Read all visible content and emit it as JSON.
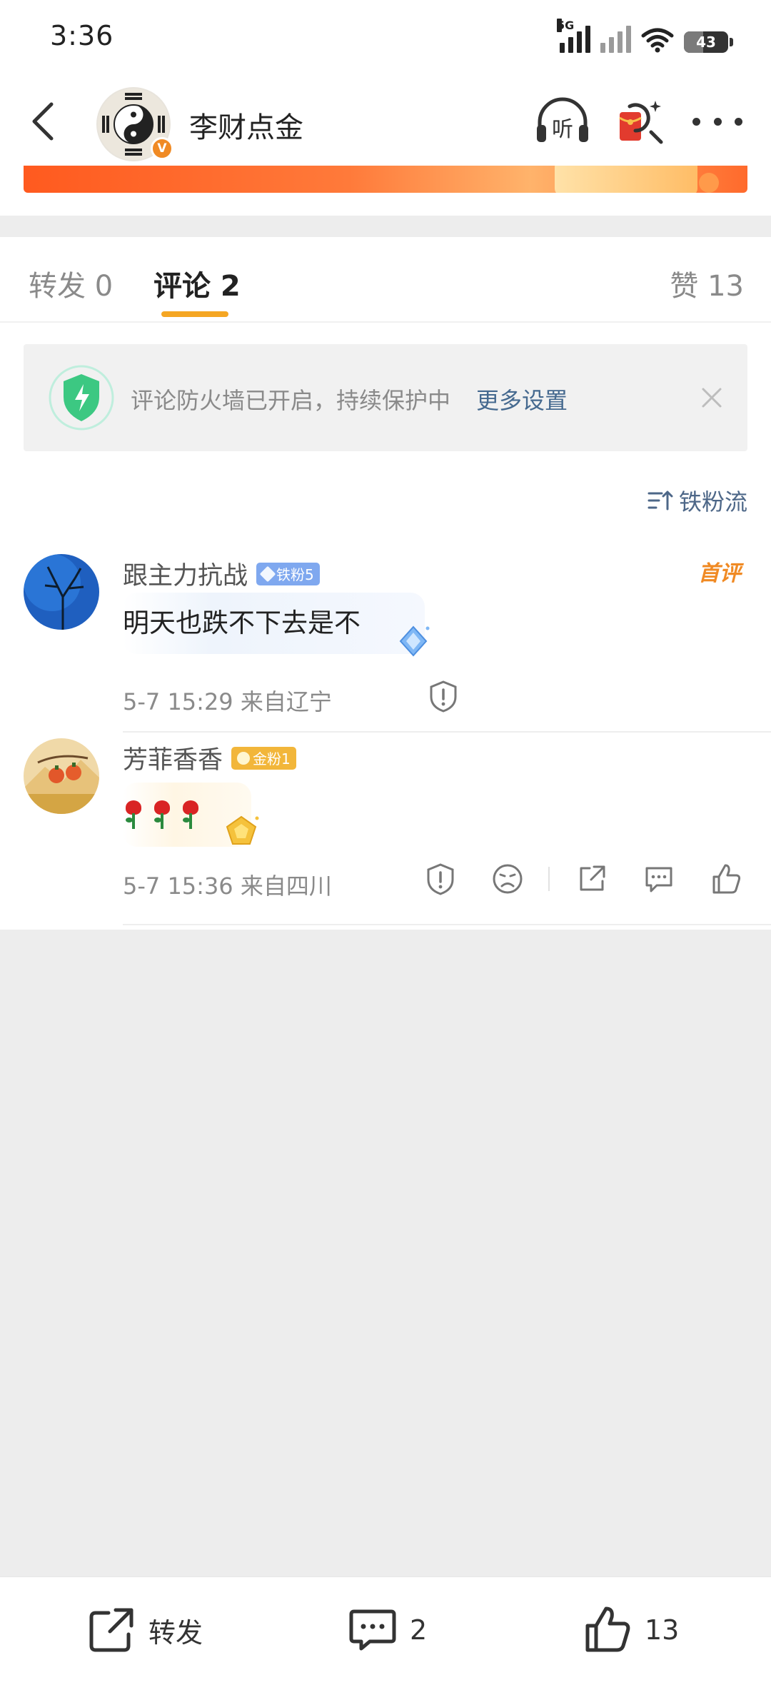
{
  "status_bar": {
    "time": "3:36",
    "network_label": "5G",
    "battery_level": "43",
    "battery_fraction": 0.43
  },
  "header": {
    "account_name": "李财点金",
    "verified_badge": "V",
    "icons": [
      "back-icon",
      "headphones-listen-icon",
      "red-envelope-search-icon",
      "more-icon"
    ],
    "listen_label": "听"
  },
  "tabs": {
    "repost": "转发 0",
    "comment": "评论 2",
    "like": "赞 13",
    "active": "comment",
    "accent_color": "#f5a623"
  },
  "firewall": {
    "message": "评论防火墙已开启，持续保护中",
    "link": "更多设置",
    "icon": "shield-lightning-icon",
    "shield_color": "#3cc882"
  },
  "sort": {
    "label": "铁粉流",
    "icon": "sort-icon"
  },
  "comments": [
    {
      "author": "跟主力抗战",
      "badge": "铁粉5",
      "badge_color": "#7fa8ef",
      "tag": "首评",
      "text": "明天也跌不下去是不",
      "meta": "5-7 15:29  来自辽宁"
    },
    {
      "author": "芳菲香香",
      "badge": "金粉1",
      "badge_color": "#f2b63a",
      "text_emoji": "rose-rose-rose",
      "meta": "5-7 15:36  来自四川",
      "actions": [
        "report-icon",
        "dislike-face-icon",
        "share-icon",
        "reply-icon",
        "like-icon"
      ]
    }
  ],
  "bottom_bar": {
    "repost_label": "转发",
    "comment_count": "2",
    "like_count": "13"
  }
}
